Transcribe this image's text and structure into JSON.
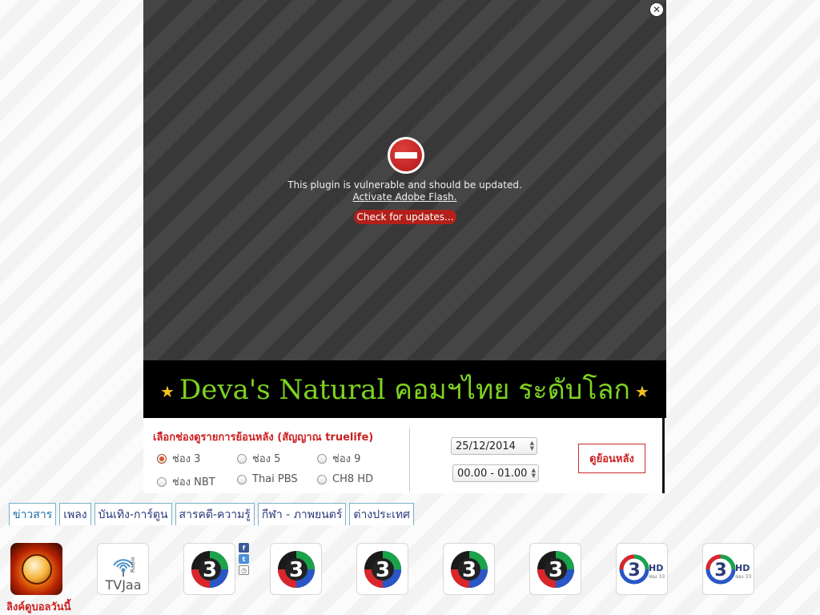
{
  "player": {
    "plugin_message": "This plugin is vulnerable and should be updated.",
    "activate_link": "Activate Adobe Flash.",
    "update_button": "Check for updates...",
    "close_glyph": "✕"
  },
  "banner": {
    "text": "Deva's Natural คอมฯไทย ระดับโลก",
    "star": "★",
    "text_color": "#7ed321",
    "star_color": "#f2c21b"
  },
  "panel": {
    "title": "เลือกช่องดูรายการย้อนหลัง (สัญญาณ truelife)",
    "channels": [
      {
        "label": "ช่อง 3",
        "selected": true
      },
      {
        "label": "ช่อง 5",
        "selected": false
      },
      {
        "label": "ช่อง 9",
        "selected": false
      },
      {
        "label": "ช่อง NBT",
        "selected": false
      },
      {
        "label": "Thai PBS",
        "selected": false
      },
      {
        "label": "CH8 HD",
        "selected": false
      }
    ],
    "date_value": "25/12/2014",
    "time_value": "00.00 - 01.00",
    "back_button": "ดูย้อนหลัง"
  },
  "tabs": [
    {
      "label": "ข่าวสาร",
      "active": true
    },
    {
      "label": "เพลง",
      "active": false
    },
    {
      "label": "บันเทิง-การ์ตูน",
      "active": false
    },
    {
      "label": "สารคดี-ความรู้",
      "active": false
    },
    {
      "label": "กีฬา - ภาพยนตร์",
      "active": false
    },
    {
      "label": "ต่างประเทศ",
      "active": false
    }
  ],
  "channel_tiles": {
    "ball_caption": "ลิงค์ดูบอลวันนี้",
    "tvjaa_radio": "Radio",
    "tvjaa_name": "TVJaa",
    "ch3_glyph": "3",
    "hd_label": "HD",
    "sub_label": "ช่อง 33",
    "share_icons": [
      "f",
      "t",
      "◷"
    ]
  }
}
